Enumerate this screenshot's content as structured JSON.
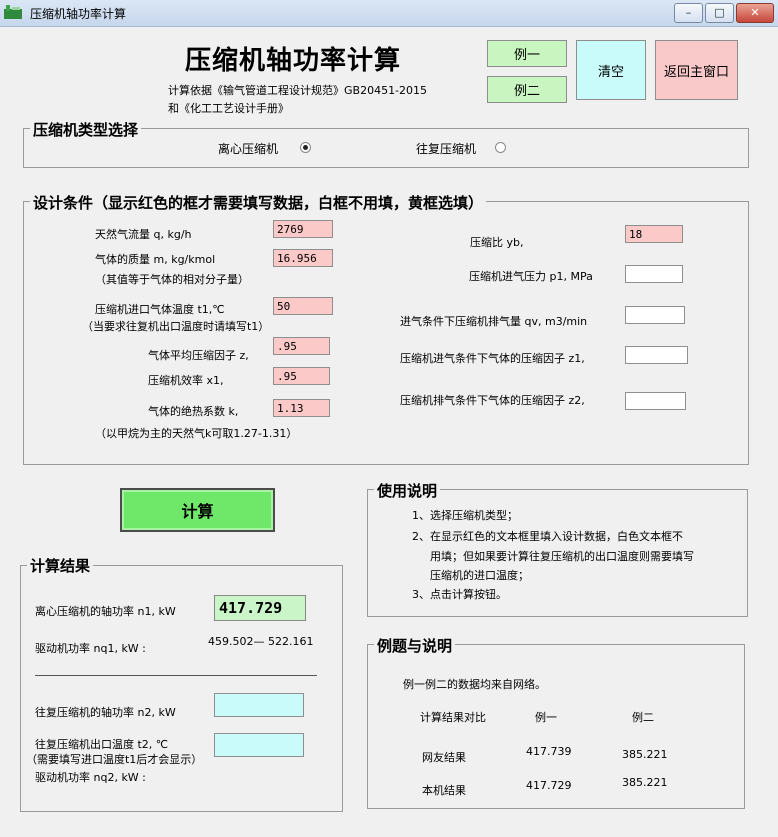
{
  "window": {
    "title": "压缩机轴功率计算",
    "min": "–",
    "max": "□",
    "close": "✕"
  },
  "header": {
    "title": "压缩机轴功率计算",
    "basis_line1": "计算依据《输气管道工程设计规范》GB20451-2015",
    "basis_line2": "和《化工工艺设计手册》"
  },
  "buttons": {
    "example1": "例一",
    "example2": "例二",
    "clear": "清空",
    "back": "返回主窗口",
    "calc": "计算"
  },
  "type_group": {
    "title": "压缩机类型选择",
    "centrifugal": "离心压缩机",
    "reciprocating": "往复压缩机",
    "selected": "centrifugal"
  },
  "design": {
    "title": "设计条件（显示红色的框才需要填写数据，白框不用填，黄框选填）",
    "flow_label": "天然气流量 q, kg/h",
    "flow_value": "2769",
    "mass_label": "气体的质量 m, kg/kmol",
    "mass_value": "16.956",
    "mass_note": "（其值等于气体的相对分子量）",
    "t1_label": "压缩机进口气体温度 t1,℃",
    "t1_value": "50",
    "t1_note": "（当要求往复机出口温度时请填写t1）",
    "z_label": "气体平均压缩因子 z,",
    "z_value": ".95",
    "eff_label": "压缩机效率 x1,",
    "eff_value": ".95",
    "k_label": "气体的绝热系数 k,",
    "k_value": "1.13",
    "k_note": "（以甲烷为主的天然气k可取1.27-1.31）",
    "ratio_label": "压缩比 yb,",
    "ratio_value": "18",
    "p1_label": "压缩机进气压力 p1, MPa",
    "p1_value": "",
    "qv_label": "进气条件下压缩机排气量  qv, m3/min",
    "qv_value": "",
    "z1_label": "压缩机进气条件下气体的压缩因子 z1,",
    "z1_value": "",
    "z2_label": "压缩机排气条件下气体的压缩因子 z2,",
    "z2_value": ""
  },
  "results": {
    "title": "计算结果",
    "n1_label": "离心压缩机的轴功率 n1, kW",
    "n1_value": "417.729",
    "nq1_label": "驱动机功率 nq1, kW :",
    "nq1_value": "459.502— 522.161",
    "n2_label": "往复压缩机的轴功率 n2,  kW",
    "n2_value": "",
    "t2_label": "往复压缩机出口温度 t2, ℃",
    "t2_note": "（需要填写进口温度t1后才会显示）",
    "t2_value": "",
    "nq2_label": "驱动机功率 nq2, kW :"
  },
  "usage": {
    "title": "使用说明",
    "line1": "1、选择压缩机类型；",
    "line2a": "2、在显示红色的文本框里填入设计数据，白色文本框不",
    "line2b": "用填；但如果要计算往复压缩机的出口温度则需要填写",
    "line2c": "压缩机的进口温度；",
    "line3": "3、点击计算按钮。"
  },
  "examples": {
    "title": "例题与说明",
    "note": "例一例二的数据均来自网络。",
    "col0": "计算结果对比",
    "col1": "例一",
    "col2": "例二",
    "row1_label": "网友结果",
    "row1_v1": "417.739",
    "row1_v2": "385.221",
    "row2_label": "本机结果",
    "row2_v1": "417.729",
    "row2_v2": "385.221"
  }
}
